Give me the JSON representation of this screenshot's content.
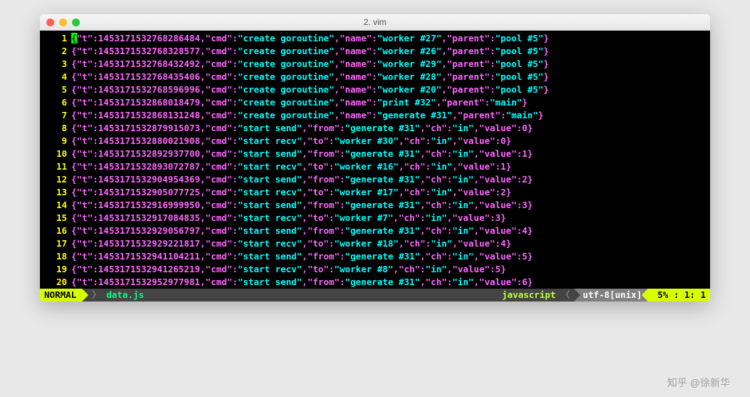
{
  "titlebar": {
    "title": "2. vim"
  },
  "status": {
    "mode": "NORMAL",
    "file": "data.js",
    "filetype": "javascript",
    "encoding": "utf-8[unix]",
    "percent": "5%",
    "line": "1",
    "col": "1"
  },
  "watermark": "知乎 @徐新华",
  "lines": [
    {
      "n": 1,
      "t": "1453171532768286484",
      "cmd": "create goroutine",
      "name": "worker #27",
      "parent": "pool #5"
    },
    {
      "n": 2,
      "t": "1453171532768328577",
      "cmd": "create goroutine",
      "name": "worker #26",
      "parent": "pool #5"
    },
    {
      "n": 3,
      "t": "1453171532768432492",
      "cmd": "create goroutine",
      "name": "worker #29",
      "parent": "pool #5"
    },
    {
      "n": 4,
      "t": "1453171532768435406",
      "cmd": "create goroutine",
      "name": "worker #28",
      "parent": "pool #5"
    },
    {
      "n": 5,
      "t": "1453171532768596996",
      "cmd": "create goroutine",
      "name": "worker #20",
      "parent": "pool #5"
    },
    {
      "n": 6,
      "t": "1453171532868018479",
      "cmd": "create goroutine",
      "name": "print #32",
      "parent": "main"
    },
    {
      "n": 7,
      "t": "1453171532868131248",
      "cmd": "create goroutine",
      "name": "generate #31",
      "parent": "main"
    },
    {
      "n": 8,
      "t": "1453171532879915073",
      "cmd": "start send",
      "from": "generate #31",
      "ch": "in",
      "value": 0
    },
    {
      "n": 9,
      "t": "1453171532880021908",
      "cmd": "start recv",
      "to": "worker #30",
      "ch": "in",
      "value": 0
    },
    {
      "n": 10,
      "t": "1453171532892937700",
      "cmd": "start send",
      "from": "generate #31",
      "ch": "in",
      "value": 1
    },
    {
      "n": 11,
      "t": "1453171532893072787",
      "cmd": "start recv",
      "to": "worker #16",
      "ch": "in",
      "value": 1
    },
    {
      "n": 12,
      "t": "1453171532904954369",
      "cmd": "start send",
      "from": "generate #31",
      "ch": "in",
      "value": 2
    },
    {
      "n": 13,
      "t": "1453171532905077725",
      "cmd": "start recv",
      "to": "worker #17",
      "ch": "in",
      "value": 2
    },
    {
      "n": 14,
      "t": "1453171532916999950",
      "cmd": "start send",
      "from": "generate #31",
      "ch": "in",
      "value": 3
    },
    {
      "n": 15,
      "t": "1453171532917084835",
      "cmd": "start recv",
      "to": "worker #7",
      "ch": "in",
      "value": 3
    },
    {
      "n": 16,
      "t": "1453171532929056797",
      "cmd": "start send",
      "from": "generate #31",
      "ch": "in",
      "value": 4
    },
    {
      "n": 17,
      "t": "1453171532929221817",
      "cmd": "start recv",
      "to": "worker #18",
      "ch": "in",
      "value": 4
    },
    {
      "n": 18,
      "t": "1453171532941104211",
      "cmd": "start send",
      "from": "generate #31",
      "ch": "in",
      "value": 5
    },
    {
      "n": 19,
      "t": "1453171532941265219",
      "cmd": "start recv",
      "to": "worker #8",
      "ch": "in",
      "value": 5
    },
    {
      "n": 20,
      "t": "1453171532952977981",
      "cmd": "start send",
      "from": "generate #31",
      "ch": "in",
      "value": 6
    }
  ]
}
